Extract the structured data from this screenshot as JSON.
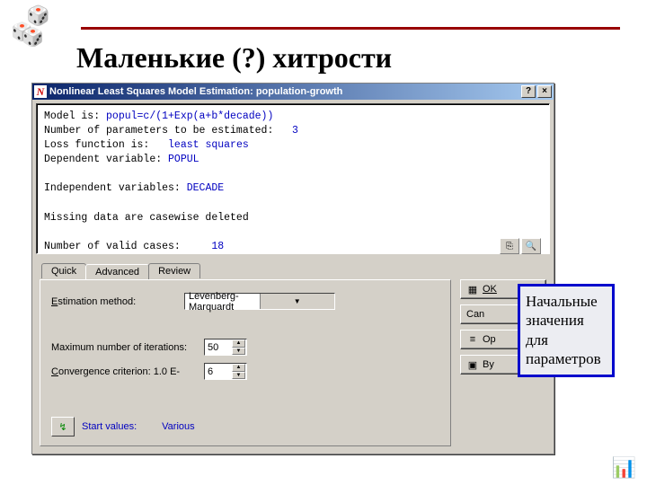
{
  "page": {
    "title": "Маленькие (?) хитрости"
  },
  "window": {
    "title": "Nonlinear Least Squares Model Estimation: population-growth",
    "help_label": "?",
    "close_label": "×"
  },
  "output": {
    "model_label": "Model is: ",
    "model_value": "popul=c/(1+Exp(a+b*decade))",
    "params_label": "Number of parameters to be estimated:   ",
    "params_value": "3",
    "loss_label": "Loss function is:   ",
    "loss_value": "least squares",
    "dep_label": "Dependent variable: ",
    "dep_value": "POPUL",
    "indep_label": "Independent variables: ",
    "indep_value": "DECADE",
    "missing_line": "Missing data are casewise deleted",
    "cases_label": "Number of valid cases:     ",
    "cases_value": "18"
  },
  "tabs": {
    "quick": "Quick",
    "advanced": "Advanced",
    "review": "Review"
  },
  "form": {
    "estimation_label_pre": "E",
    "estimation_label": "stimation method:",
    "estimation_value": "Levenberg-Marquardt",
    "max_iter_label": "Maximum number of iterations:",
    "max_iter_value": "50",
    "conv_label_pre": "C",
    "conv_label": "onvergence criterion:     1.0 E-",
    "conv_value": "6",
    "start_label_pre": "S",
    "start_label": "tart values:",
    "start_value": "Various"
  },
  "buttons": {
    "ok": "OK",
    "cancel": "Can",
    "options": "Op",
    "bygroup": "By"
  },
  "callout": {
    "text": "Начальные значения для параметров"
  },
  "icons": {
    "copy": "⎘",
    "zoom": "🔍",
    "ok_grid": "▦",
    "options_bars": "≡",
    "bygroup": "▣",
    "start_arrow": "↯"
  }
}
